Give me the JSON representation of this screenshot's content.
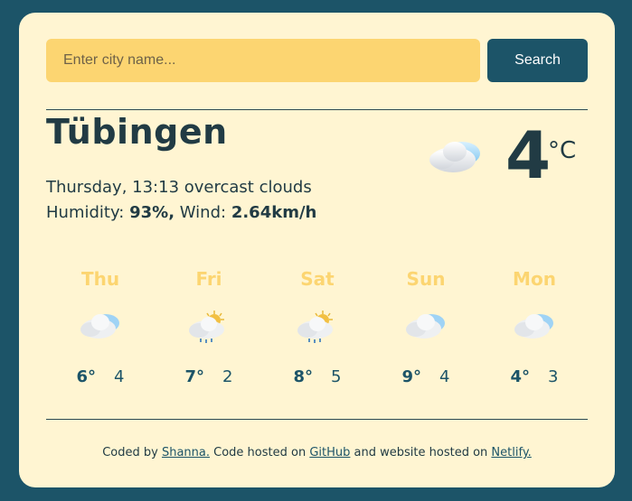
{
  "search": {
    "placeholder": "Enter city name...",
    "button_label": "Search"
  },
  "current": {
    "city": "Tübingen",
    "day_time": "Thursday, 13:13",
    "description": "overcast clouds",
    "humidity_label": "Humidity:",
    "humidity_value": "93%,",
    "wind_label": "Wind:",
    "wind_value": "2.64km/h",
    "temperature": "4",
    "unit": "°C",
    "icon": "overcast-clouds-icon"
  },
  "forecast": [
    {
      "day": "Thu",
      "max": "6°",
      "min": "4",
      "icon": "cloud-icon"
    },
    {
      "day": "Fri",
      "max": "7°",
      "min": "2",
      "icon": "sun-rain-cloud-icon"
    },
    {
      "day": "Sat",
      "max": "8°",
      "min": "5",
      "icon": "sun-rain-cloud-icon"
    },
    {
      "day": "Sun",
      "max": "9°",
      "min": "4",
      "icon": "cloud-icon"
    },
    {
      "day": "Mon",
      "max": "4°",
      "min": "3",
      "icon": "cloud-icon"
    }
  ],
  "footer": {
    "prefix": "Coded by",
    "author_link": "Shanna.",
    "middle": "Code hosted on",
    "github_link": "GitHub",
    "middle2": "and website hosted on",
    "netlify_link": "Netlify."
  },
  "colors": {
    "background": "#1c5468",
    "card": "#fff5d2",
    "accent_yellow": "#fcd571",
    "text_dark": "#213b44"
  }
}
